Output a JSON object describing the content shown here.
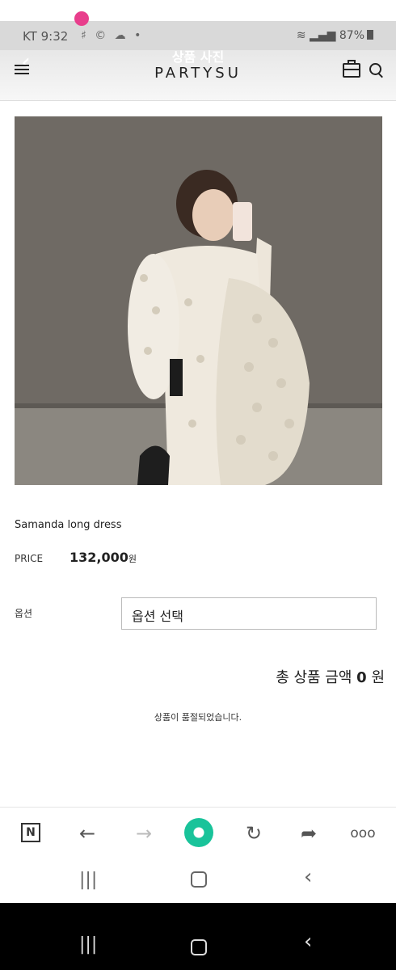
{
  "status_bar": {
    "carrier": "KT",
    "time": "9:32",
    "left_icons": "♯ © ☁ •",
    "battery": "87%"
  },
  "header": {
    "overlay_title": "상품 사진",
    "logo": "PARTYSU"
  },
  "product": {
    "name": "Samanda long dress",
    "price_label": "PRICE",
    "price": "132,000",
    "currency": "원",
    "option_label": "옵션",
    "option_placeholder": "옵션 선택",
    "total_text": "총 상품 금액",
    "total_value": "0",
    "total_unit": "원",
    "soldout_msg": "상품이 품절되었습니다."
  },
  "toolbar": {
    "n_label": "N",
    "back_icon": "←",
    "forward_icon": "→",
    "refresh_icon": "↻",
    "share_icon": "➦",
    "more_icon": "ooo"
  },
  "system_nav": {
    "recents": "|||",
    "back": "‹"
  },
  "colors": {
    "accent": "#19c39a",
    "photo_bg": "#6a645e"
  }
}
